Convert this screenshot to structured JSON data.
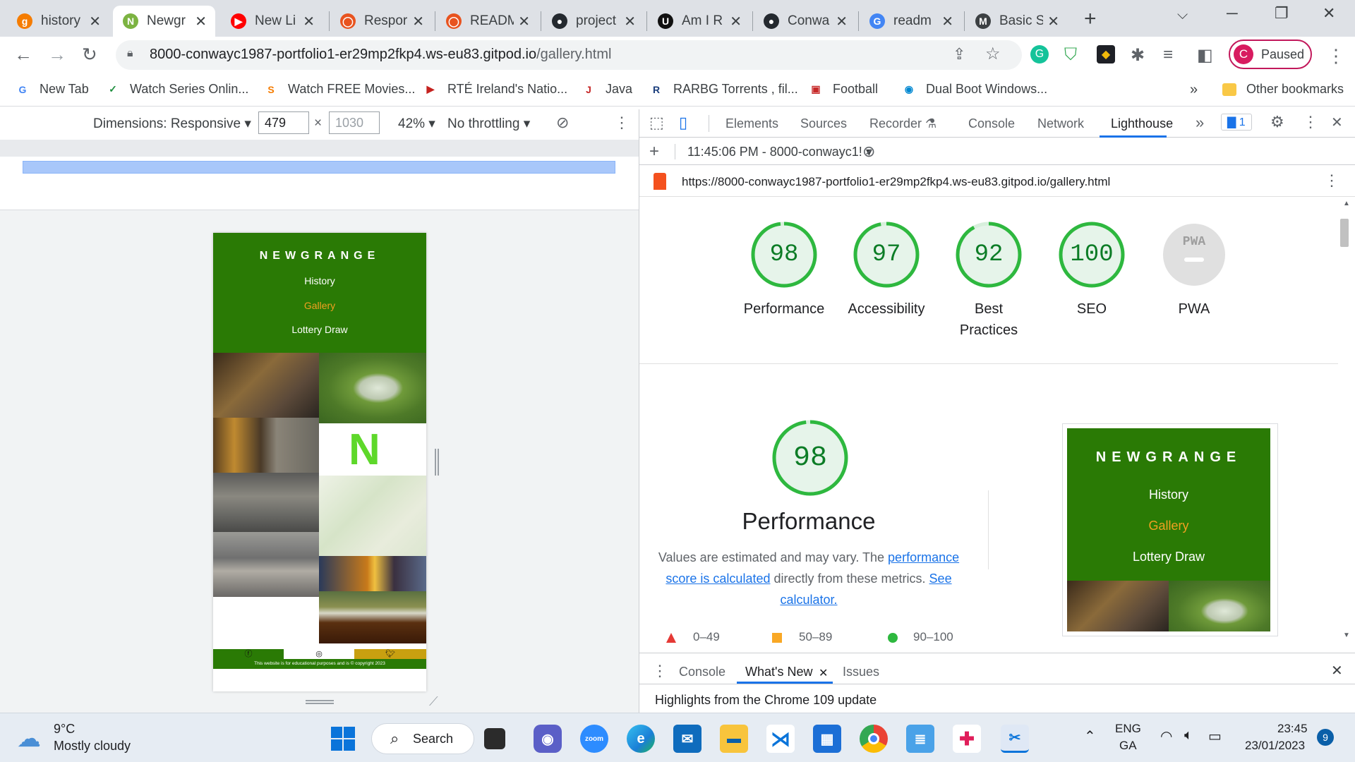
{
  "tabs": [
    {
      "title": "history",
      "icon": "g",
      "color": "#f57c00"
    },
    {
      "title": "Newgr",
      "icon": "N",
      "color": "#7cb342"
    },
    {
      "title": "New Li",
      "icon": "▶",
      "color": "#ff0000"
    },
    {
      "title": "Respor",
      "icon": "◯",
      "color": "#e8531f"
    },
    {
      "title": "READM",
      "icon": "◯",
      "color": "#e8531f"
    },
    {
      "title": "project",
      "icon": "●",
      "color": "#24292f"
    },
    {
      "title": "Am I R",
      "icon": "U",
      "color": "#111111"
    },
    {
      "title": "Conwa",
      "icon": "●",
      "color": "#24292f"
    },
    {
      "title": "readm",
      "icon": "G",
      "color": "#4285f4"
    },
    {
      "title": "Basic S",
      "icon": "M",
      "color": "#3c4043"
    }
  ],
  "address": {
    "host": "8000-conwayc1987-portfolio1-er29mp2fkp4.ws-eu83.gitpod.io",
    "path": "/gallery.html"
  },
  "profile": {
    "initial": "C",
    "label": "Paused"
  },
  "bookmarks": [
    {
      "label": "New Tab",
      "icon": "G",
      "color": "#4285f4"
    },
    {
      "label": "Watch Series Onlin...",
      "icon": "✓",
      "color": "#1e8e3e"
    },
    {
      "label": "Watch FREE Movies...",
      "icon": "S",
      "color": "#f57c00"
    },
    {
      "label": "RTÉ Ireland's Natio...",
      "icon": "▶",
      "color": "#c5221f"
    },
    {
      "label": "Java",
      "icon": "J",
      "color": "#c62828"
    },
    {
      "label": "RARBG Torrents , fil...",
      "icon": "R",
      "color": "#1a3d7c"
    },
    {
      "label": "Football",
      "icon": "▣",
      "color": "#c62828"
    },
    {
      "label": "Dual Boot Windows...",
      "icon": "◉",
      "color": "#0288d1"
    }
  ],
  "bookmarks_more": "»",
  "other_bookmarks": "Other bookmarks",
  "device_toolbar": {
    "dimensions_label": "Dimensions: Responsive",
    "width": "479",
    "height_placeholder": "1030",
    "times": "×",
    "zoom": "42%",
    "throttling": "No throttling"
  },
  "site": {
    "brand": "NEWGRANGE",
    "nav": [
      "History",
      "Gallery",
      "Lottery Draw"
    ],
    "current_nav": "Gallery",
    "footer_text": "This website is for educational purposes and is © copyright 2023",
    "social": [
      "facebook",
      "instagram",
      "twitter"
    ]
  },
  "devtools": {
    "tabs": [
      "Elements",
      "Sources",
      "Recorder",
      "Console",
      "Network",
      "Lighthouse"
    ],
    "active_tab": "Lighthouse",
    "issues_count": "1",
    "report_time": "11:45:06 PM - 8000-conwayc1!",
    "report_url": "https://8000-conwayc1987-portfolio1-er29mp2fkp4.ws-eu83.gitpod.io/gallery.html",
    "scores": [
      {
        "label": "Performance",
        "value": "98"
      },
      {
        "label": "Accessibility",
        "value": "97"
      },
      {
        "label": "Best Practices",
        "value": "92"
      },
      {
        "label": "SEO",
        "value": "100"
      },
      {
        "label": "PWA",
        "value": "PWA"
      }
    ],
    "performance": {
      "score": "98",
      "title": "Performance",
      "desc_before": "Values are estimated and may vary. The ",
      "link1": "performance score is calculated",
      "desc_mid": " directly from these metrics. ",
      "link2": "See calculator.",
      "legend": [
        {
          "range": "0–49",
          "color": "#e53935"
        },
        {
          "range": "50–89",
          "color": "#f9a825"
        },
        {
          "range": "90–100",
          "color": "#2eb83f"
        }
      ]
    },
    "drawer": {
      "tabs": [
        "Console",
        "What's New",
        "Issues"
      ],
      "active": "What's New",
      "highlight": "Highlights from the Chrome 109 update"
    }
  },
  "taskbar": {
    "weather_temp": "9°C",
    "weather_desc": "Mostly cloudy",
    "search_label": "Search",
    "lang1": "ENG",
    "lang2": "GA",
    "time": "23:45",
    "date": "23/01/2023",
    "notifications": "9"
  }
}
